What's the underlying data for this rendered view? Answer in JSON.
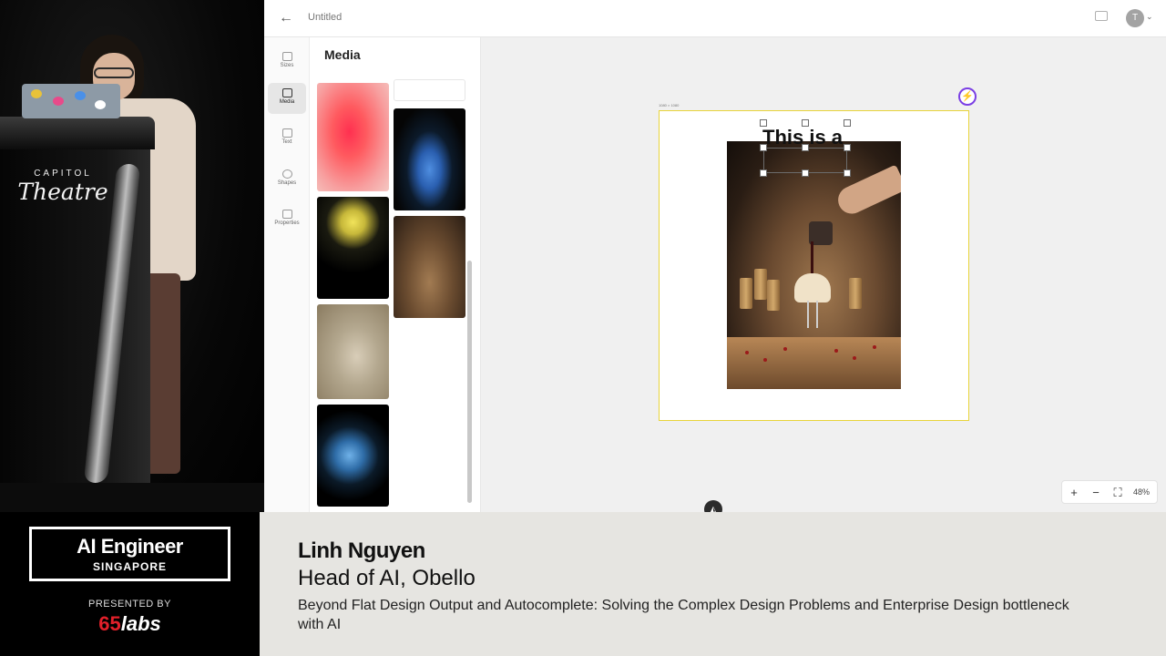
{
  "stage": {
    "podium_small_text": "CAPITOL",
    "podium_big_text": "Theatre"
  },
  "app": {
    "doc_title": "Untitled",
    "avatar_initial": "T",
    "tools": [
      {
        "label": "Sizes"
      },
      {
        "label": "Media"
      },
      {
        "label": "Text"
      },
      {
        "label": "Shapes"
      },
      {
        "label": "Properties"
      }
    ],
    "active_tool": "Media",
    "panel_title": "Media",
    "canvas": {
      "frame_size_label": "1080 × 1080",
      "text_layer": "This is a",
      "zoom": "48%",
      "zoom_in": "+",
      "zoom_out": "−",
      "fit": "⛶"
    }
  },
  "lower_third": {
    "brand_title": "AI Engineer",
    "brand_sub": "SINGAPORE",
    "presented_by": "PRESENTED BY",
    "sponsor_num": "65",
    "sponsor_word": "labs",
    "speaker_name": "Linh Nguyen",
    "speaker_role": "Head of AI, Obello",
    "talk_title": "Beyond Flat Design Output and Autocomplete: Solving the Complex Design Problems and Enterprise Design bottleneck with AI"
  },
  "colors": {
    "accent_purple": "#7b3fe4",
    "artboard_border": "#e8d43a",
    "sponsor_red": "#e2202a"
  }
}
